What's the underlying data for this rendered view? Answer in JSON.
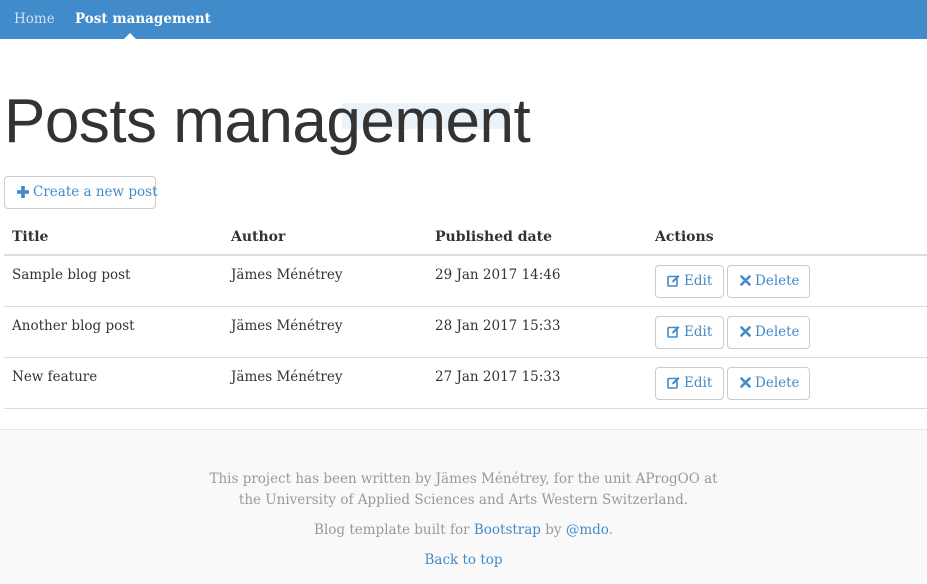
{
  "nav": {
    "home": "Home",
    "posts": "Post management"
  },
  "page": {
    "title": "Posts management",
    "create_label": "Create a new post"
  },
  "table": {
    "headers": [
      "Title",
      "Author",
      "Published date",
      "Actions"
    ],
    "rows": [
      {
        "title": "Sample blog post",
        "author": "Jämes Ménétrey",
        "date": "29 Jan 2017 14:46"
      },
      {
        "title": "Another blog post",
        "author": "Jämes Ménétrey",
        "date": "28 Jan 2017 15:33"
      },
      {
        "title": "New feature",
        "author": "Jämes Ménétrey",
        "date": "27 Jan 2017 15:33"
      }
    ],
    "edit_label": "Edit",
    "delete_label": "Delete"
  },
  "footer": {
    "line1": "This project has been written by Jämes Ménétrey, for the unit AProgOO at",
    "line2": "the University of Applied Sciences and Arts Western Switzerland.",
    "template_prefix": "Blog template built for ",
    "bootstrap": "Bootstrap",
    "by": " by ",
    "mdo": "@mdo",
    "period": ".",
    "back_to_top": "Back to top"
  },
  "colors": {
    "navbar": "#428bca",
    "link": "#428bca",
    "footer_bg": "#f9f9f9"
  }
}
